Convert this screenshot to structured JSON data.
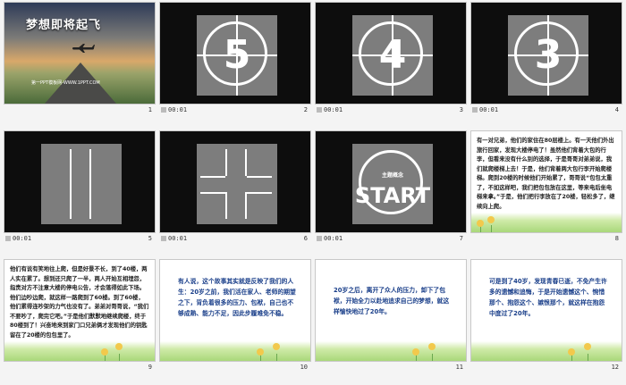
{
  "slides": [
    {
      "num": "1",
      "time": "",
      "title": "梦想即将起飞",
      "subtitle": "第一PPT模板网-WWW.1PPT.COM"
    },
    {
      "num": "2",
      "time": "00:01",
      "digit": "5"
    },
    {
      "num": "3",
      "time": "00:01",
      "digit": "4"
    },
    {
      "num": "4",
      "time": "00:01",
      "digit": "3"
    },
    {
      "num": "5",
      "time": "00:01"
    },
    {
      "num": "6",
      "time": "00:01"
    },
    {
      "num": "7",
      "time": "00:01",
      "sub": "主题概念",
      "word": "START"
    },
    {
      "num": "8",
      "time": "",
      "text": "有一对兄弟，他们的家住在80层楼上。有一天他们外出旅行回家，发现大楼停电了！虽然他们背着大包的行李，但看来没有什么别的选择，于是哥哥对弟弟说，我们就爬楼梯上去！于是，他们背着两大包行李开始爬楼梯。爬到20楼的时候他们开始累了，哥哥说“包包太重了，不如这样吧，我们把包包放在这里，等来电后坐电梯来拿。”于是，他们把行李放在了20楼，轻松多了，继续向上爬。"
    },
    {
      "num": "9",
      "time": "",
      "text": "他们有说有笑地往上爬，但是好景不长，到了40楼，两人实在累了。想到还只爬了一半，两人开始互相埋怨，指责对方不注意大楼的停电公告，才会落得如此下场。他们边吵边爬，就这样一路爬到了60楼。到了60楼，他们累得连吵架的力气也没有了。弟弟对哥哥说，“我们不要吵了，爬完它吧。”于是他们默默地继续爬楼，终于80楼到了！兴奋地来到家门口兄弟俩才发现他们的钥匙留在了20楼的包包里了。"
    },
    {
      "num": "10",
      "time": "",
      "text": "有人说，这个故事其实就是反映了我们的人生：20岁之前，我们活在家人、老师的期望之下，背负着很多的压力、包袱，自己也不够成熟、能力不足，因此步履难免不稳。"
    },
    {
      "num": "11",
      "time": "",
      "text": "20岁之后，离开了众人的压力，卸下了包袱，开始全力以赴地追求自己的梦想，就这样愉快地过了20年。"
    },
    {
      "num": "12",
      "time": "",
      "text": "可是到了40岁，发现青春已逝，不免产生许多的遗憾和追悔，于是开始遗憾这个、惋惜那个、抱怨这个、嫉恨那个，就这样在抱怨中度过了20年。"
    }
  ]
}
